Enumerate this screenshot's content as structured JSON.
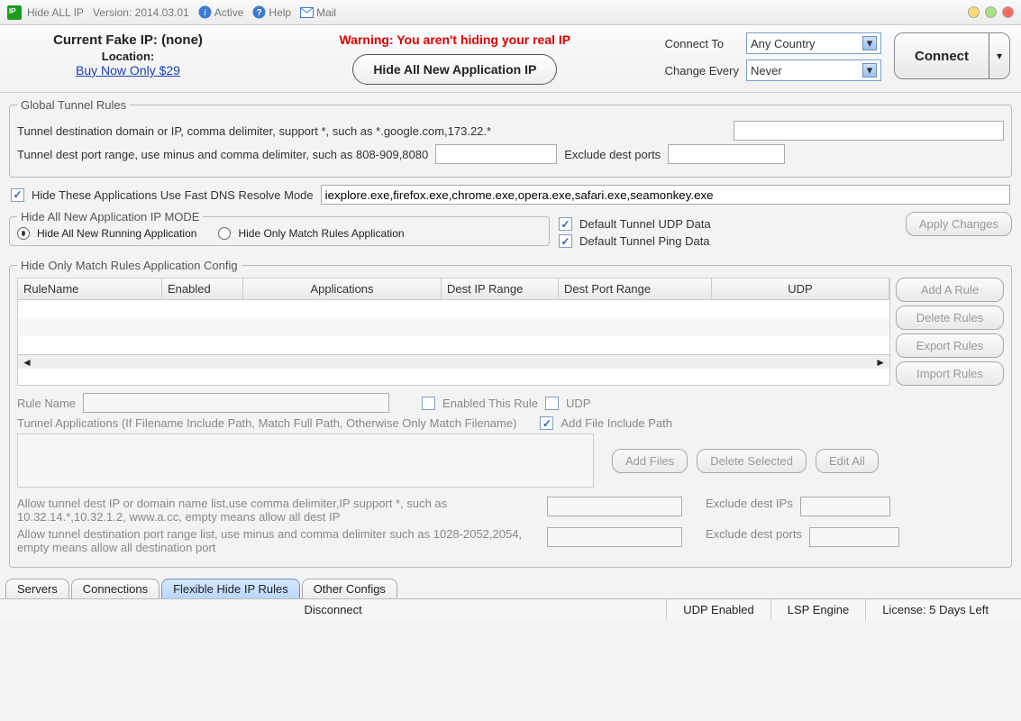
{
  "titlebar": {
    "app": "Hide ALL IP",
    "version": "Version: 2014.03.01",
    "active": "Active",
    "help": "Help",
    "mail": "Mail"
  },
  "header": {
    "ip_label": "Current Fake IP:",
    "ip_value": "(none)",
    "location_label": "Location:",
    "buy_link": "Buy Now Only $29",
    "warning": "Warning: You aren't hiding your real IP",
    "hide_btn": "Hide All New Application IP",
    "connect_to": "Connect To",
    "country": "Any Country",
    "change_every": "Change Every",
    "interval": "Never",
    "connect": "Connect"
  },
  "global": {
    "legend": "Global Tunnel Rules",
    "dest_domain_label": "Tunnel destination domain or IP, comma delimiter, support *, such as *.google.com,173.22.*",
    "dest_port_label": "Tunnel dest port range, use minus and comma delimiter, such as 808-909,8080",
    "exclude_port_label": "Exclude dest ports"
  },
  "dns": {
    "label": "Hide These Applications Use Fast DNS Resolve Mode",
    "value": "iexplore.exe,firefox.exe,chrome.exe,opera.exe,safari.exe,seamonkey.exe"
  },
  "mode": {
    "legend": "Hide All New Application IP MODE",
    "opt1": "Hide All New Running Application",
    "opt2": "Hide Only Match Rules Application",
    "udp": "Default Tunnel UDP Data",
    "ping": "Default Tunnel Ping Data",
    "apply": "Apply Changes"
  },
  "config": {
    "legend": "Hide Only Match Rules Application Config",
    "cols": {
      "rulename": "RuleName",
      "enabled": "Enabled",
      "applications": "Applications",
      "destip": "Dest IP Range",
      "destport": "Dest Port Range",
      "udp": "UDP"
    },
    "btns": {
      "add": "Add A Rule",
      "del": "Delete Rules",
      "exp": "Export Rules",
      "imp": "Import Rules"
    },
    "rule_name": "Rule Name",
    "enabled_rule": "Enabled This Rule",
    "udp_cb": "UDP",
    "tunnel_apps": "Tunnel Applications (If Filename Include Path, Match Full Path, Otherwise Only Match Filename)",
    "add_path": "Add File Include Path",
    "add_files": "Add Files",
    "del_sel": "Delete Selected",
    "edit_all": "Edit All",
    "allow_ip": "Allow tunnel dest IP or domain name list,use comma delimiter,IP support *, such as 10.32.14.*,10.32.1.2, www.a.cc, empty means allow all dest IP",
    "exclude_ip": "Exclude dest IPs",
    "allow_port": "Allow tunnel destination port range list, use minus and comma delimiter such as 1028-2052,2054, empty means allow all destination port",
    "exclude_port": "Exclude dest ports"
  },
  "tabs": {
    "servers": "Servers",
    "connections": "Connections",
    "flexible": "Flexible Hide IP Rules",
    "other": "Other Configs"
  },
  "status": {
    "disconnect": "Disconnect",
    "udp": "UDP Enabled",
    "lsp": "LSP Engine",
    "license": "License: 5 Days Left"
  }
}
